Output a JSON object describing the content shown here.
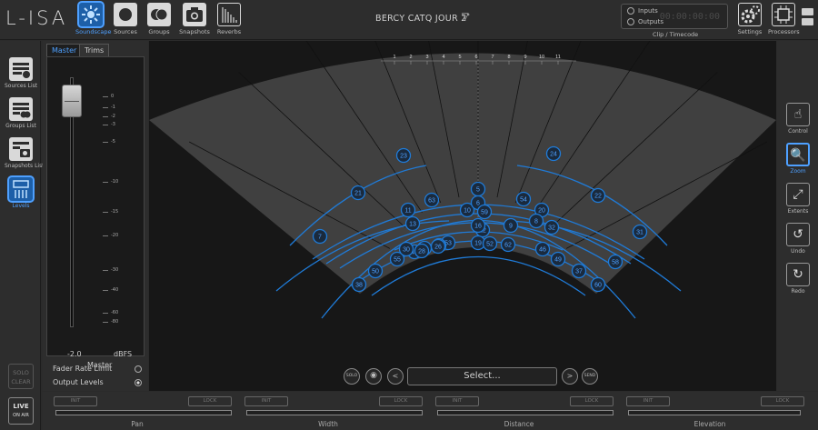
{
  "app": {
    "logo": "L-ISA",
    "show_title": "BERCY CATQ JOUR 2",
    "show_title_suffix": "*",
    "show_caret": "▽"
  },
  "top_nav": [
    {
      "label": "Soundscape",
      "icon": "soundscape-icon",
      "active": true
    },
    {
      "label": "Sources",
      "icon": "sources-icon",
      "active": false
    },
    {
      "label": "Groups",
      "icon": "groups-icon",
      "active": false
    },
    {
      "label": "Snapshots",
      "icon": "camera-icon",
      "active": false
    },
    {
      "label": "Reverbs",
      "icon": "reverbs-icon",
      "active": false
    }
  ],
  "clock": {
    "inputs_label": "Inputs",
    "outputs_label": "Outputs",
    "timecode": "00:00:00:00",
    "caption": "Clip / Timecode"
  },
  "top_right": [
    {
      "label": "Settings",
      "icon": "gear-icon"
    },
    {
      "label": "Processors",
      "icon": "processor-icon"
    }
  ],
  "left_nav": [
    {
      "label": "Sources List",
      "icon": "list-icon",
      "active": false
    },
    {
      "label": "Groups List",
      "icon": "list-icon",
      "active": false
    },
    {
      "label": "Snapshots List",
      "icon": "camera-list-icon",
      "active": false
    },
    {
      "label": "Levels",
      "icon": "levels-icon",
      "active": true
    }
  ],
  "solo_clear": {
    "line1": "SOLO",
    "line2": "CLEAR"
  },
  "live_air": {
    "line1": "LIVE",
    "line2": "ON AIR"
  },
  "fader_panel": {
    "tabs": [
      {
        "label": "Master",
        "active": true
      },
      {
        "label": "Trims",
        "active": false
      }
    ],
    "scale": [
      "0",
      "-1",
      "-2",
      "-3",
      "-5",
      "-10",
      "-15",
      "-20",
      "-30",
      "-40",
      "-60",
      "-80"
    ],
    "value": "-2.0",
    "unit": "dBFS",
    "name": "Master",
    "fader_level_fraction": 0.92,
    "options": [
      {
        "label": "Fader Rate Limit",
        "checked": false
      },
      {
        "label": "Output Levels",
        "checked": true
      }
    ]
  },
  "soundscape": {
    "ruler": [
      "1",
      "2",
      "3",
      "4",
      "5",
      "6",
      "7",
      "8",
      "9",
      "10",
      "11"
    ],
    "accent": "#1f7bd8",
    "sources": [
      "23",
      "24",
      "21",
      "22",
      "5",
      "63",
      "54",
      "11",
      "20",
      "10",
      "8",
      "6",
      "59",
      "13",
      "9",
      "7",
      "31",
      "32",
      "12",
      "16",
      "19",
      "52",
      "53",
      "62",
      "64",
      "27",
      "45",
      "26",
      "55",
      "46",
      "37",
      "50",
      "49",
      "58",
      "60",
      "38",
      "28",
      "30"
    ]
  },
  "select_bar": {
    "solo": "SOLO",
    "eye": "eye-icon",
    "prev": "<",
    "select_label": "Select...",
    "next": ">",
    "send": "SEND"
  },
  "right_tools": [
    {
      "label": "Control",
      "icon": "hand-icon",
      "active": false
    },
    {
      "label": "Zoom",
      "icon": "zoom-icon",
      "active": true
    },
    {
      "label": "Extents",
      "icon": "extents-icon",
      "active": false
    },
    {
      "label": "Undo",
      "icon": "undo-icon",
      "active": false
    },
    {
      "label": "Redo",
      "icon": "redo-icon",
      "active": false
    }
  ],
  "params": [
    {
      "label": "Pan",
      "init": "INIT",
      "lock": "LOCK"
    },
    {
      "label": "Width",
      "init": "INIT",
      "lock": "LOCK"
    },
    {
      "label": "Distance",
      "init": "INIT",
      "lock": "LOCK"
    },
    {
      "label": "Elevation",
      "init": "INIT",
      "lock": "LOCK"
    }
  ]
}
